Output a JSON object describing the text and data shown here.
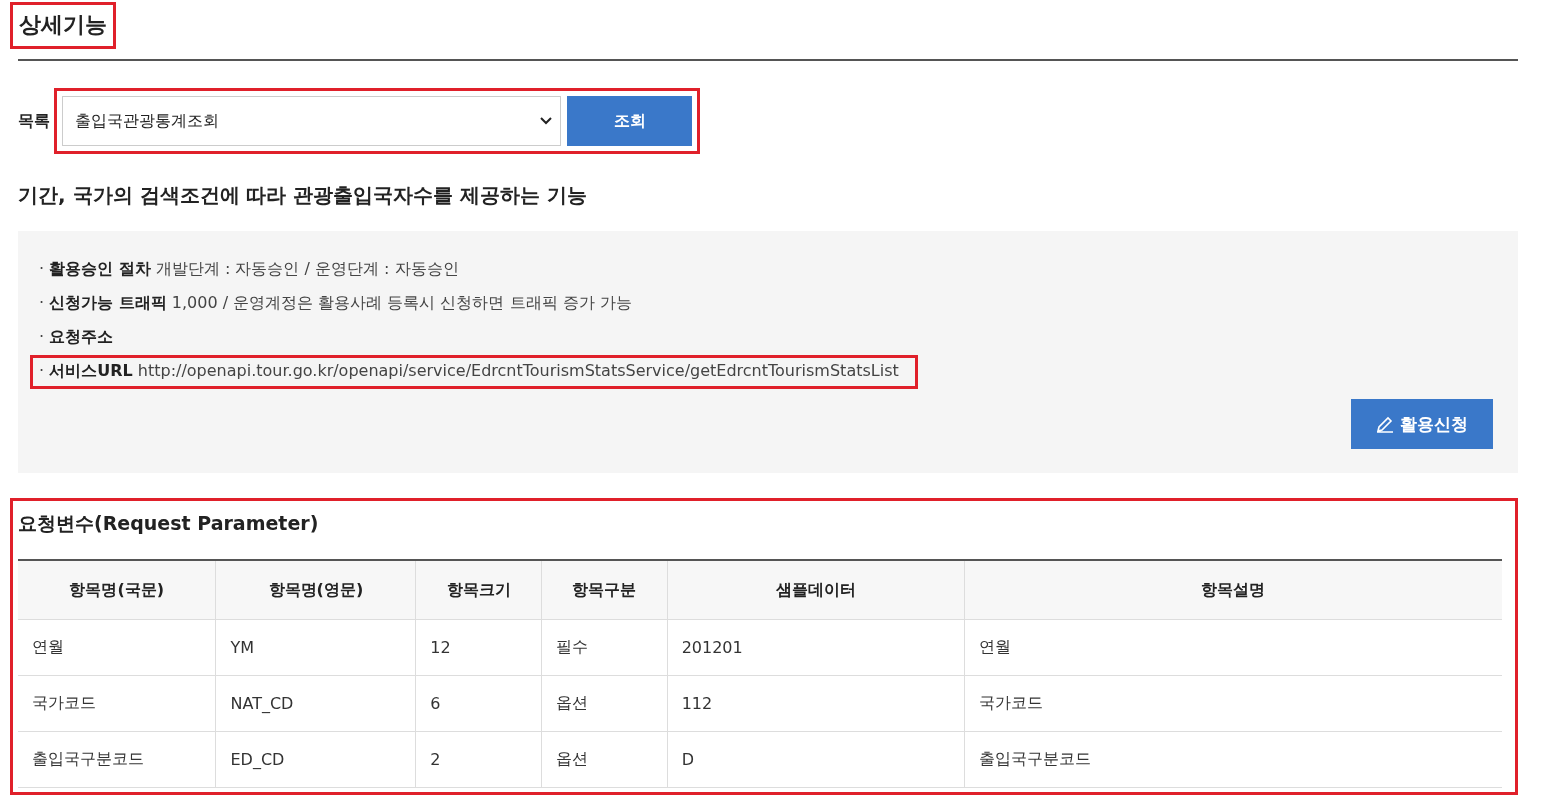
{
  "section_title": {
    "text": "상세기능",
    "highlighted": true
  },
  "list_row": {
    "label": "목록",
    "select_value": "출입국관광통계조회",
    "button": "조회",
    "highlighted": true
  },
  "description": "기간, 국가의 검색조건에 따라 관광출입국자수를 제공하는 기능",
  "info_panel": {
    "lines": [
      {
        "bullet": "·",
        "label": "활용승인 절차",
        "text": "개발단계 : 자동승인 / 운영단계 : 자동승인",
        "highlighted": false
      },
      {
        "bullet": "·",
        "label": "신청가능 트래픽",
        "text": "1,000 / 운영계정은 활용사례 등록시 신청하면 트래픽 증가 가능",
        "highlighted": false
      },
      {
        "bullet": "·",
        "label": "요청주소",
        "highlighted": false
      },
      {
        "bullet": "·",
        "label": "서비스URL",
        "text": "http://openapi.tour.go.kr/openapi/service/EdrcntTourismStatsService/getEdrcntTourismStatsList",
        "highlighted": true
      }
    ],
    "apply_button": "활용신청"
  },
  "request_section": {
    "title": "요청변수(Request Parameter)",
    "highlighted": true,
    "table": {
      "columns": [
        "항목명(국문)",
        "항목명(영문)",
        "항목크기",
        "항목구분",
        "샘플데이터",
        "항목설명"
      ],
      "rows": [
        [
          "연월",
          "YM",
          "12",
          "필수",
          "201201",
          "연월"
        ],
        [
          "국가코드",
          "NAT_CD",
          "6",
          "옵션",
          "112",
          "국가코드"
        ],
        [
          "출입국구분코드",
          "ED_CD",
          "2",
          "옵션",
          "D",
          "출입국구분코드"
        ]
      ]
    }
  }
}
